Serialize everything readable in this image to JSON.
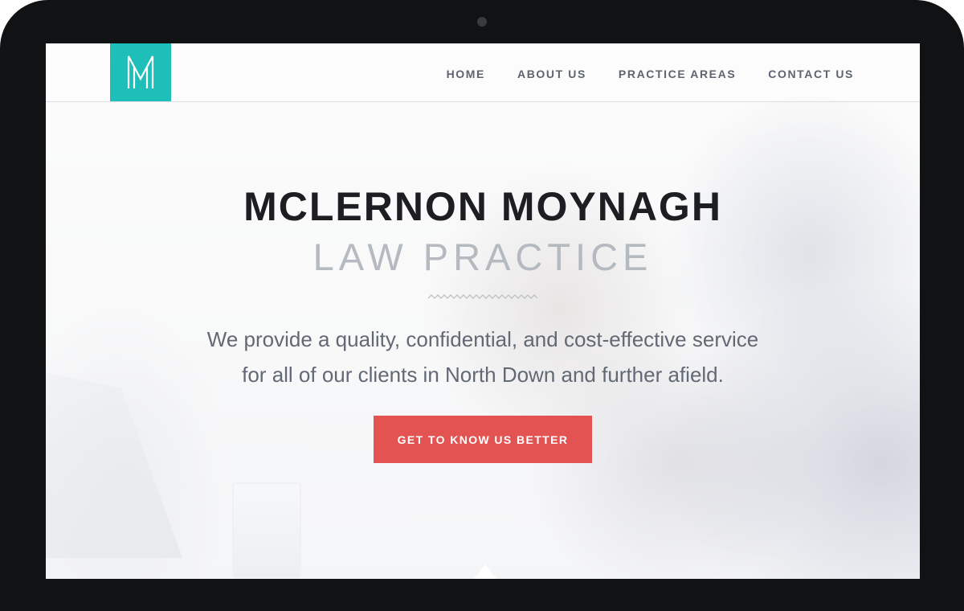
{
  "logo": {
    "letter": "M",
    "color": "#1dbfb8"
  },
  "nav": {
    "items": [
      {
        "label": "HOME"
      },
      {
        "label": "ABOUT US"
      },
      {
        "label": "PRACTICE AREAS"
      },
      {
        "label": "CONTACT US"
      }
    ]
  },
  "hero": {
    "title": "MCLERNON MOYNAGH",
    "subtitle": "LAW PRACTICE",
    "tagline_line1": "We provide a quality, confidential, and cost-effective service",
    "tagline_line2": "for all of our clients in North Down and further afield.",
    "cta_label": "GET TO KNOW US BETTER",
    "cta_color": "#e35352"
  },
  "icons": {
    "logo": "m-monogram-icon",
    "divider": "zigzag-divider-icon",
    "scroll": "caret-up-icon",
    "camera": "camera-icon"
  }
}
